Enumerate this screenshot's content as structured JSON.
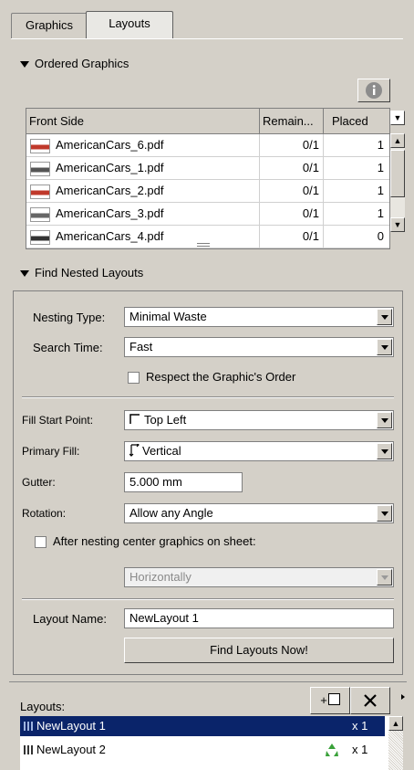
{
  "tabs": [
    {
      "label": "Graphics"
    },
    {
      "label": "Layouts"
    }
  ],
  "ordered_graphics": {
    "title": "Ordered Graphics",
    "columns": [
      "Front Side",
      "Remain...",
      "Placed"
    ],
    "rows": [
      {
        "name": "AmericanCars_6.pdf",
        "remain": "0/1",
        "placed": "1"
      },
      {
        "name": "AmericanCars_1.pdf",
        "remain": "0/1",
        "placed": "1"
      },
      {
        "name": "AmericanCars_2.pdf",
        "remain": "0/1",
        "placed": "1"
      },
      {
        "name": "AmericanCars_3.pdf",
        "remain": "0/1",
        "placed": "1"
      },
      {
        "name": "AmericanCars_4.pdf",
        "remain": "0/1",
        "placed": "0"
      }
    ]
  },
  "find_nested": {
    "title": "Find Nested Layouts",
    "nesting_type_label": "Nesting Type:",
    "nesting_type_value": "Minimal Waste",
    "search_time_label": "Search Time:",
    "search_time_value": "Fast",
    "respect_order_label": "Respect the Graphic's Order",
    "fill_start_label": "Fill Start Point:",
    "fill_start_value": "Top Left",
    "primary_fill_label": "Primary Fill:",
    "primary_fill_value": "Vertical",
    "gutter_label": "Gutter:",
    "gutter_value": "5.000 mm",
    "rotation_label": "Rotation:",
    "rotation_value": "Allow any Angle",
    "center_label": "After nesting center graphics on sheet:",
    "center_value": "Horizontally",
    "layout_name_label": "Layout Name:",
    "layout_name_value": "NewLayout 1",
    "find_button": "Find Layouts Now!"
  },
  "layouts": {
    "label": "Layouts:",
    "add_button": "+",
    "items": [
      {
        "name": "NewLayout 1",
        "count": "x 1"
      },
      {
        "name": "NewLayout 2",
        "count": "x 1"
      }
    ]
  },
  "colors": {
    "selection": "#0a246a",
    "panel": "#d4d0c8"
  }
}
